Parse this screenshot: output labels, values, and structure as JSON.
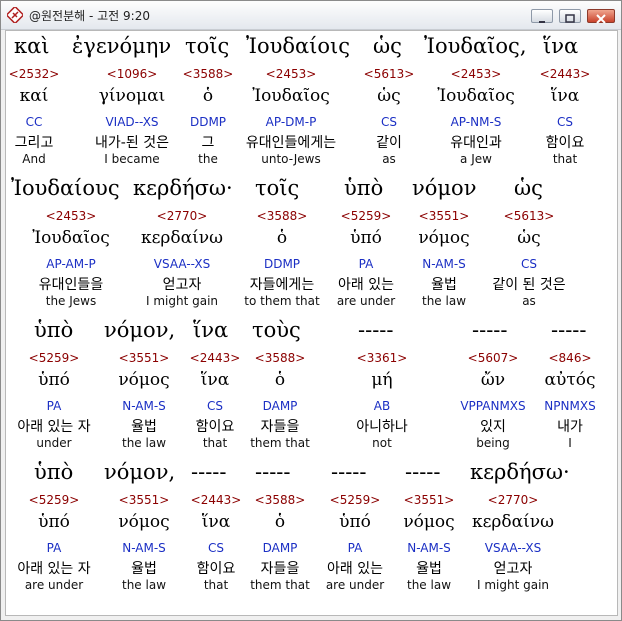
{
  "window": {
    "title": "@원전분해 - 고전 9:20",
    "controls": {
      "minimize_icon": "minimize-icon",
      "maximize_icon": "maximize-icon",
      "close_icon": "close-icon"
    }
  },
  "rows": [
    {
      "greek": [
        "καὶ",
        "ἐγενόμην",
        "τοῖς",
        "Ἰουδαίοις",
        "ὡς",
        "Ἰουδαῖος,",
        "ἵνα"
      ],
      "words": [
        {
          "strong": "<2532>",
          "lemma": "καί",
          "morph": "CC",
          "korean": "그리고",
          "english": "And"
        },
        {
          "strong": "<1096>",
          "lemma": "γίνομαι",
          "morph": "VIAD--XS",
          "korean": "내가-된 것은",
          "english": "I became"
        },
        {
          "strong": "<3588>",
          "lemma": "ὁ",
          "morph": "DDMP",
          "korean": "그",
          "english": "the"
        },
        {
          "strong": "<2453>",
          "lemma": "Ἰουδαῖος",
          "morph": "AP-DM-P",
          "korean": "유대인들에게는",
          "english": "unto-Jews"
        },
        {
          "strong": "<5613>",
          "lemma": "ὡς",
          "morph": "CS",
          "korean": "같이",
          "english": "as"
        },
        {
          "strong": "<2453>",
          "lemma": "Ἰουδαῖος",
          "morph": "AP-NM-S",
          "korean": "유대인과",
          "english": "a Jew"
        },
        {
          "strong": "<2443>",
          "lemma": "ἵνα",
          "morph": "CS",
          "korean": "함이요",
          "english": "that"
        }
      ]
    },
    {
      "greek": [
        "Ἰουδαίους",
        "κερδήσω·",
        "τοῖς",
        "ὑπὸ",
        "νόμον",
        "ὡς"
      ],
      "words": [
        {
          "strong": "<2453>",
          "lemma": "Ἰουδαῖος",
          "morph": "AP-AM-P",
          "korean": "유대인들을",
          "english": "the Jews"
        },
        {
          "strong": "<2770>",
          "lemma": "κερδαίνω",
          "morph": "VSAA--XS",
          "korean": "얻고자",
          "english": "I might gain"
        },
        {
          "strong": "<3588>",
          "lemma": "ὁ",
          "morph": "DDMP",
          "korean": "자들에게는",
          "english": "to them that"
        },
        {
          "strong": "<5259>",
          "lemma": "ὑπό",
          "morph": "PA",
          "korean": "아래 있는",
          "english": "are under"
        },
        {
          "strong": "<3551>",
          "lemma": "νόμος",
          "morph": "N-AM-S",
          "korean": "율법",
          "english": "the law"
        },
        {
          "strong": "<5613>",
          "lemma": "ὡς",
          "morph": "CS",
          "korean": "같이 된 것은",
          "english": "as"
        }
      ]
    },
    {
      "greek": [
        "ὑπὸ",
        "νόμον,",
        "ἵνα",
        "τοὺς",
        "-----",
        "-----",
        "-----"
      ],
      "words": [
        {
          "strong": "<5259>",
          "lemma": "ὑπό",
          "morph": "PA",
          "korean": "아래 있는 자",
          "english": "under"
        },
        {
          "strong": "<3551>",
          "lemma": "νόμος",
          "morph": "N-AM-S",
          "korean": "율법",
          "english": "the law"
        },
        {
          "strong": "<2443>",
          "lemma": "ἵνα",
          "morph": "CS",
          "korean": "함이요",
          "english": "that"
        },
        {
          "strong": "<3588>",
          "lemma": "ὁ",
          "morph": "DAMP",
          "korean": "자들을",
          "english": "them that"
        },
        {
          "strong": "<3361>",
          "lemma": "μή",
          "morph": "AB",
          "korean": "아니하나",
          "english": "not"
        },
        {
          "strong": "<5607>",
          "lemma": "ὤν",
          "morph": "VPPANMXS",
          "korean": "있지",
          "english": "being"
        },
        {
          "strong": "<846>",
          "lemma": "αὐτός",
          "morph": "NPNMXS",
          "korean": "내가",
          "english": "I"
        }
      ]
    },
    {
      "greek": [
        "ὑπὸ",
        "νόμον,",
        "-----",
        "-----",
        "-----",
        "-----",
        "κερδήσω·"
      ],
      "words": [
        {
          "strong": "<5259>",
          "lemma": "ὑπό",
          "morph": "PA",
          "korean": "아래 있는 자",
          "english": "are under"
        },
        {
          "strong": "<3551>",
          "lemma": "νόμος",
          "morph": "N-AM-S",
          "korean": "율법",
          "english": "the law"
        },
        {
          "strong": "<2443>",
          "lemma": "ἵνα",
          "morph": "CS",
          "korean": "함이요",
          "english": "that"
        },
        {
          "strong": "<3588>",
          "lemma": "ὁ",
          "morph": "DAMP",
          "korean": "자들을",
          "english": "them that"
        },
        {
          "strong": "<5259>",
          "lemma": "ὑπό",
          "morph": "PA",
          "korean": "아래 있는",
          "english": "are under"
        },
        {
          "strong": "<3551>",
          "lemma": "νόμος",
          "morph": "N-AM-S",
          "korean": "율법",
          "english": "the law"
        },
        {
          "strong": "<2770>",
          "lemma": "κερδαίνω",
          "morph": "VSAA--XS",
          "korean": "얻고자",
          "english": "I might gain"
        }
      ]
    }
  ]
}
